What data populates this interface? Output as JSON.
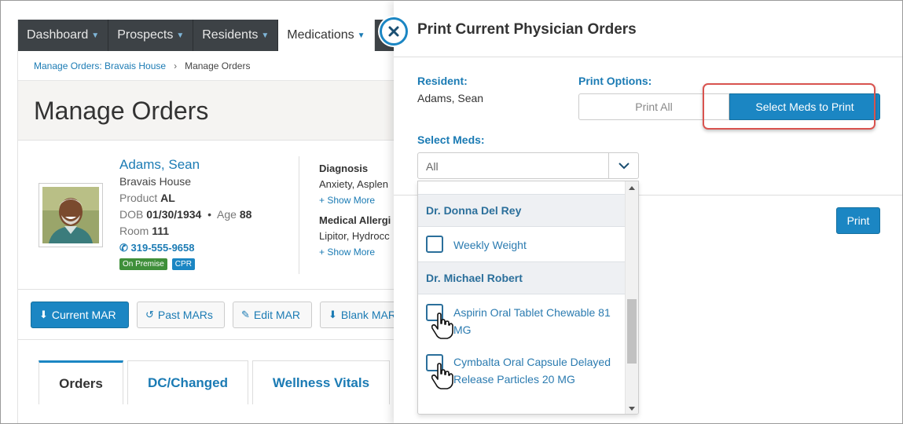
{
  "nav": {
    "items": [
      {
        "label": "Dashboard",
        "active": false
      },
      {
        "label": "Prospects",
        "active": false
      },
      {
        "label": "Residents",
        "active": false
      },
      {
        "label": "Medications",
        "active": true
      }
    ]
  },
  "breadcrumb": {
    "link": "Manage Orders: Bravais House",
    "current": "Manage Orders"
  },
  "page": {
    "title": "Manage Orders"
  },
  "resident": {
    "name": "Adams, Sean",
    "facility": "Bravais House",
    "product_label": "Product",
    "product": "AL",
    "dob_label": "DOB",
    "dob": "01/30/1934",
    "age_label": "Age",
    "age": "88",
    "room_label": "Room",
    "room": "111",
    "phone": "319-555-9658",
    "badge_premise": "On Premise",
    "badge_cpr": "CPR"
  },
  "clinical": {
    "diagnosis_label": "Diagnosis",
    "diagnosis": "Anxiety, Asplen",
    "allergy_label": "Medical Allergi",
    "allergies": "Lipitor, Hydrocc",
    "show_more": "Show More"
  },
  "actions": {
    "current_mar": "Current MAR",
    "past_mars": "Past MARs",
    "edit_mar": "Edit MAR",
    "blank_mar": "Blank MAR"
  },
  "tabs": [
    "Orders",
    "DC/Changed",
    "Wellness Vitals"
  ],
  "panel": {
    "title": "Print Current Physician Orders",
    "resident_label": "Resident:",
    "resident_value": "Adams, Sean",
    "print_options_label": "Print Options:",
    "print_all": "Print All",
    "select_meds_to_print": "Select Meds to Print",
    "select_meds_label": "Select Meds:",
    "select_value": "All",
    "print": "Print"
  },
  "dropdown": {
    "groups": [
      {
        "physician": "Dr. Donna Del Rey",
        "meds": [
          "Weekly Weight"
        ]
      },
      {
        "physician": "Dr. Michael Robert",
        "meds": [
          "Aspirin Oral Tablet Chewable 81 MG",
          "Cymbalta Oral Capsule Delayed Release Particles 20 MG"
        ]
      }
    ]
  },
  "colors": {
    "accent": "#1b86c3",
    "nav_bg": "#3d4246",
    "highlight": "#d9534f",
    "group_bg": "#eef0f3"
  }
}
